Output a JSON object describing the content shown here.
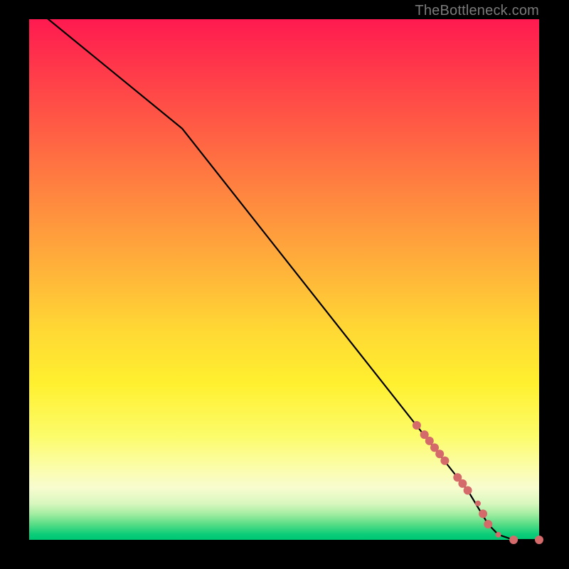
{
  "attribution": "TheBottleneck.com",
  "chart_data": {
    "type": "line",
    "title": "",
    "xlabel": "",
    "ylabel": "",
    "xlim": [
      0,
      100
    ],
    "ylim": [
      0,
      100
    ],
    "series": [
      {
        "name": "bottleneck-curve",
        "x": [
          0,
          30,
          86,
          90,
          92,
          95,
          100
        ],
        "values": [
          103,
          79,
          9.5,
          3,
          1,
          0,
          0
        ]
      }
    ],
    "markers": {
      "name": "highlighted-points",
      "color": "#d56a6a",
      "points": [
        {
          "x": 76,
          "y": 22,
          "r": 6
        },
        {
          "x": 77.5,
          "y": 20.2,
          "r": 6
        },
        {
          "x": 78.5,
          "y": 19,
          "r": 6
        },
        {
          "x": 79.5,
          "y": 17.7,
          "r": 6
        },
        {
          "x": 80.5,
          "y": 16.5,
          "r": 6
        },
        {
          "x": 81.5,
          "y": 15.2,
          "r": 6
        },
        {
          "x": 84,
          "y": 12,
          "r": 6
        },
        {
          "x": 85,
          "y": 10.8,
          "r": 6
        },
        {
          "x": 86,
          "y": 9.5,
          "r": 6
        },
        {
          "x": 88,
          "y": 7,
          "r": 4
        },
        {
          "x": 89,
          "y": 5,
          "r": 6
        },
        {
          "x": 90,
          "y": 3,
          "r": 6
        },
        {
          "x": 92,
          "y": 1,
          "r": 4
        },
        {
          "x": 95,
          "y": 0,
          "r": 6
        },
        {
          "x": 100,
          "y": 0,
          "r": 6
        }
      ]
    },
    "background_gradient": {
      "top": "#ff1a50",
      "mid": "#fff02f",
      "bottom": "#00c774"
    }
  }
}
